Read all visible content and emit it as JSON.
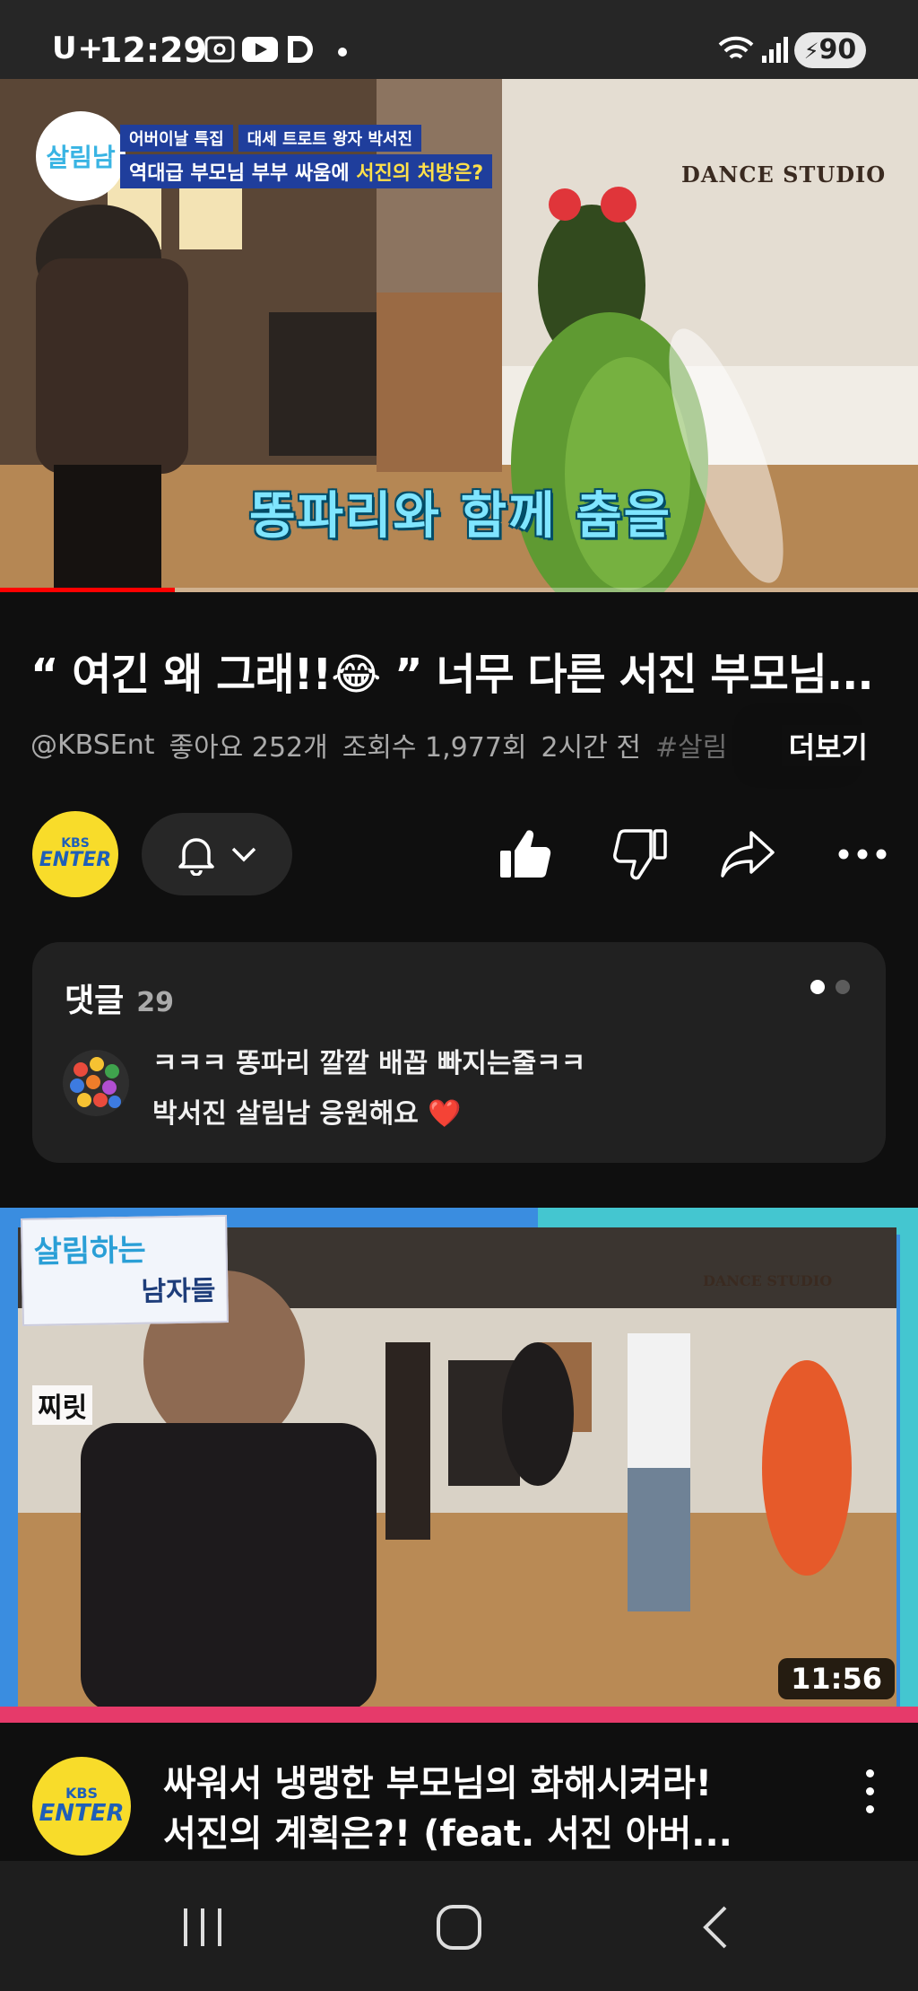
{
  "status_bar": {
    "carrier": "U+",
    "time": "12:29",
    "battery": "90"
  },
  "player": {
    "banner_tag1": "어버이날 특집",
    "banner_tag2": "대세 트로트 왕자 박서진",
    "banner_main": "역대급 부모님 부부 싸움에",
    "banner_highlight": "서진의 처방은?",
    "show_logo": "살림남",
    "studio_sign": "DANCE STUDIO",
    "subtitle": "똥파리와 함께 춤을",
    "progress_percent": 19
  },
  "video": {
    "title": "“ 여긴 왜 그래!!😂 ” 너무 다른 서진 부모님...",
    "channel_handle": "@KBSEnt",
    "likes": "좋아요 252개",
    "views": "조회수 1,977회",
    "posted": "2시간 전",
    "hashtag": "#살림",
    "more_label": "더보기"
  },
  "channel": {
    "avatar_small": "KBS",
    "avatar_main": "ENTER"
  },
  "comments": {
    "label": "댓글",
    "count": "29",
    "line1": "ㅋㅋㅋ 똥파리 깔깔 배꼽 빠지는줄ㅋㅋ",
    "line2": "박서진 살림남 응원해요 ❤️"
  },
  "recommended": {
    "logo_line1": "살림하는",
    "logo_line2": "남자들",
    "sfx": "찌릿",
    "studio_sign": "DANCE STUDIO",
    "duration": "11:56",
    "title_line1": "싸워서 냉랭한 부모님의 화해시켜라!",
    "title_line2": "서진의 계획은?! (feat. 서진 아버..."
  },
  "icons": {
    "like": "thumbs-up-icon",
    "dislike": "thumbs-down-icon",
    "share": "share-icon",
    "more": "more-horizontal-icon",
    "bell": "bell-icon"
  }
}
